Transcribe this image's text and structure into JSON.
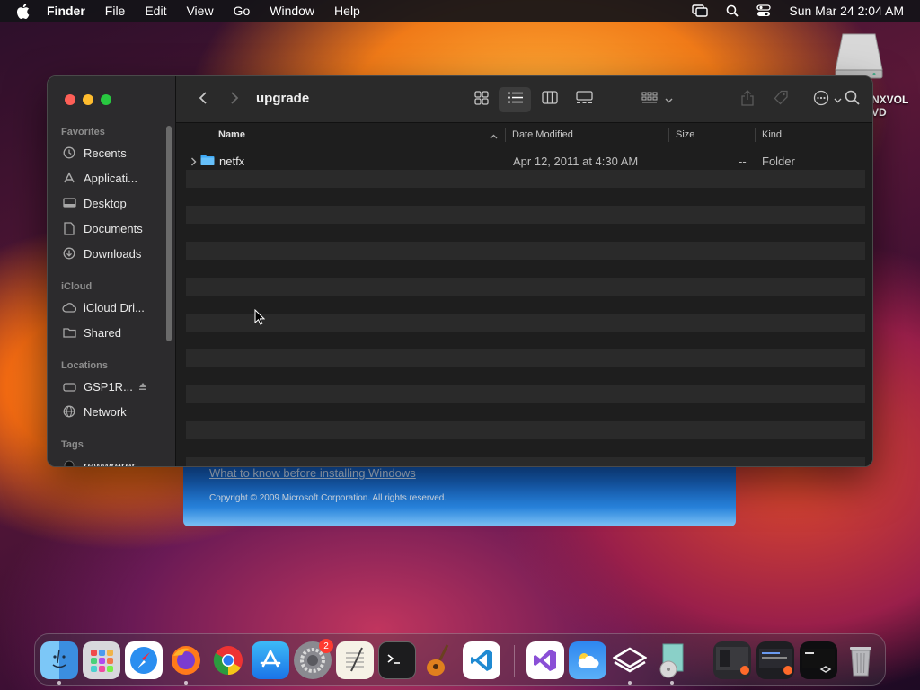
{
  "menubar": {
    "app_name": "Finder",
    "menus": [
      "File",
      "Edit",
      "View",
      "Go",
      "Window",
      "Help"
    ],
    "clock": "Sun Mar 24  2:04 AM"
  },
  "desktop": {
    "disk_label": "NXVOL\nVD"
  },
  "installer": {
    "link": "What to know before installing Windows",
    "copyright": "Copyright © 2009 Microsoft Corporation. All rights reserved."
  },
  "finder": {
    "title": "upgrade",
    "sidebar": {
      "favorites_header": "Favorites",
      "favorites": [
        {
          "label": "Recents",
          "icon": "clock-icon"
        },
        {
          "label": "Applicati...",
          "icon": "applications-icon"
        },
        {
          "label": "Desktop",
          "icon": "desktop-icon"
        },
        {
          "label": "Documents",
          "icon": "document-icon"
        },
        {
          "label": "Downloads",
          "icon": "download-icon"
        }
      ],
      "icloud_header": "iCloud",
      "icloud": [
        {
          "label": "iCloud Dri...",
          "icon": "cloud-icon"
        },
        {
          "label": "Shared",
          "icon": "shared-folder-icon"
        }
      ],
      "locations_header": "Locations",
      "locations": [
        {
          "label": "GSP1R...",
          "icon": "drive-icon"
        },
        {
          "label": "Network",
          "icon": "network-icon"
        }
      ],
      "tags_header": "Tags",
      "tags": [
        {
          "label": "rewwrerer",
          "color": "#111111"
        }
      ]
    },
    "columns": {
      "name": "Name",
      "date": "Date Modified",
      "size": "Size",
      "kind": "Kind"
    },
    "files": [
      {
        "name": "netfx",
        "date": "Apr 12, 2011 at 4:30 AM",
        "size": "--",
        "kind": "Folder"
      }
    ]
  },
  "dock": {
    "apps": [
      "Finder",
      "Launchpad",
      "Safari",
      "Firefox",
      "Chrome",
      "App Store",
      "System Settings",
      "TextEdit",
      "Terminal",
      "GarageBand",
      "Visual Studio Code",
      "Visual Studio",
      "Weather",
      "Parallels",
      "Disk Utility",
      "Firefox window",
      "Editor window",
      "Terminal window",
      "Trash"
    ],
    "settings_badge": "2"
  }
}
